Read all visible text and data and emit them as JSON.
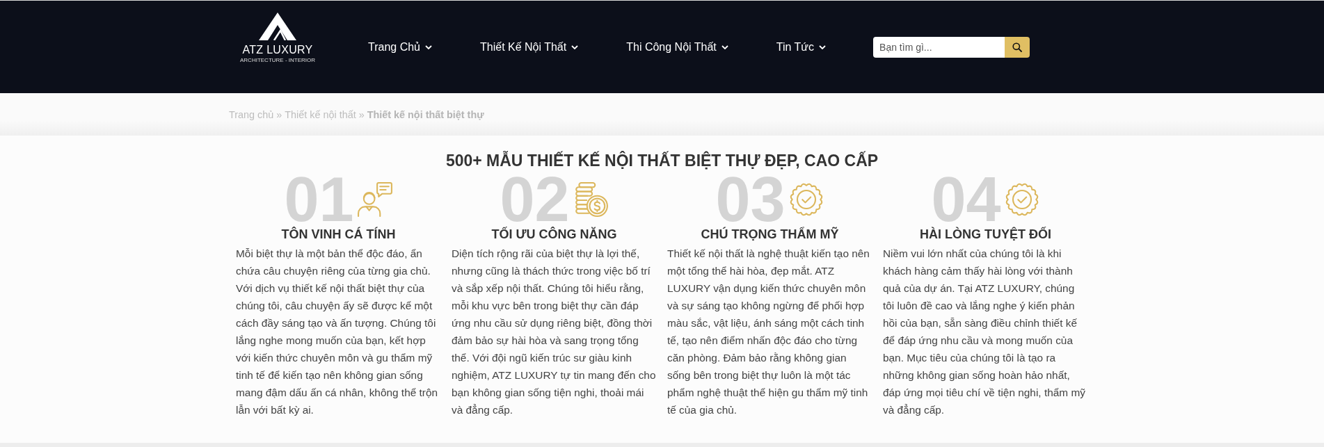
{
  "header": {
    "logo": {
      "name": "ATZ LUXURY",
      "tagline": "ARCHITECTURE - INTERIOR"
    },
    "nav": [
      {
        "label": "Trang Chủ",
        "dropdown": true
      },
      {
        "label": "Thiết Kế Nội Thất",
        "dropdown": true
      },
      {
        "label": "Thi Công Nội Thất",
        "dropdown": true
      },
      {
        "label": "Tin Tức",
        "dropdown": true
      }
    ],
    "search": {
      "placeholder": "Bạn tìm gì..."
    }
  },
  "breadcrumb": [
    {
      "label": "Trang chủ",
      "current": false,
      "separator": "»"
    },
    {
      "label": "Thiết kế nội thất",
      "current": false,
      "separator": "»"
    },
    {
      "label": "Thiết kế nội thất biệt thự",
      "current": true
    }
  ],
  "section": {
    "title": "500+ MẪU THIẾT KẾ NỘI THẤT BIỆT THỰ ĐẸP, CAO CẤP",
    "features": [
      {
        "number": "01",
        "kind": "consult",
        "title": "TÔN VINH CÁ TÍNH",
        "text": "Mỗi biệt thự là một bản thể độc đáo, ẩn chứa câu chuyện riêng của từng gia chủ. Với dịch vụ thiết kế nội thất biệt thự của chúng tôi, câu chuyện ấy sẽ được kể một cách đầy sáng tạo và ấn tượng. Chúng tôi lắng nghe mong muốn của bạn, kết hợp với kiến thức chuyên môn và gu thẩm mỹ tinh tế để kiến tạo nên không gian sống mang đậm dấu ấn cá nhân, không thể trộn lẫn với bất kỳ ai."
      },
      {
        "number": "02",
        "kind": "savings",
        "title": "TỐI ƯU CÔNG NĂNG",
        "text": "Diện tích rộng rãi của biệt thự là lợi thế, nhưng cũng là thách thức trong việc bố trí và sắp xếp nội thất. Chúng tôi hiểu rằng, mỗi khu vực bên trong biệt thự cần đáp ứng nhu cầu sử dụng riêng biệt, đồng thời đảm bảo sự hài hòa và sang trọng tổng thể. Với đội ngũ kiến trúc sư giàu kinh nghiệm, ATZ LUXURY tự tin mang đến cho bạn không gian sống tiện nghi, thoải mái và đẳng cấp."
      },
      {
        "number": "03",
        "kind": "quality",
        "title": "CHÚ TRỌNG THẨM MỸ",
        "text": "Thiết kế nội thất là nghệ thuật kiến tạo nên một tổng thể hài hòa, đẹp mắt. ATZ LUXURY vận dụng kiến thức chuyên môn và sự sáng tạo không ngừng để phối hợp màu sắc, vật liệu, ánh sáng một cách tinh tế, tạo nên điểm nhấn độc đáo cho từng căn phòng. Đảm bảo rằng không gian sống bên trong biệt thự luôn là một tác phẩm nghệ thuật thể hiện gu thẩm mỹ tinh tế của gia chủ."
      },
      {
        "number": "04",
        "kind": "quality",
        "title": "HÀI LÒNG TUYỆT ĐỐI",
        "text": "Niềm vui lớn nhất của chúng tôi là khi khách hàng cảm thấy hài lòng với thành quả của dự án. Tại ATZ LUXURY, chúng tôi luôn đề cao và lắng nghe ý kiến phản hồi của bạn, sẵn sàng điều chỉnh thiết kế để đáp ứng nhu cầu và mong muốn của bạn. Mục tiêu của chúng tôi là tạo ra những không gian sống hoàn hảo nhất, đáp ứng mọi tiêu chí về tiện nghi, thẩm mỹ và đẳng cấp."
      }
    ]
  }
}
